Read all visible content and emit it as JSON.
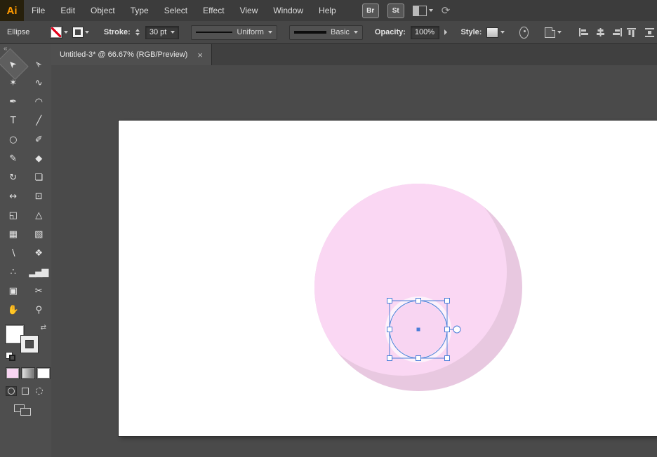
{
  "app": {
    "logo": "Ai"
  },
  "menubar": {
    "items": [
      "File",
      "Edit",
      "Object",
      "Type",
      "Select",
      "Effect",
      "View",
      "Window",
      "Help"
    ],
    "bridge_badge": "Br",
    "stock_badge": "St",
    "sync_glyph": "⟳"
  },
  "controls": {
    "tool_label": "Ellipse",
    "stroke_label": "Stroke:",
    "stroke_value": "30 pt",
    "profile_value": "Uniform",
    "brush_value": "Basic",
    "opacity_label": "Opacity:",
    "opacity_value": "100%",
    "style_label": "Style:"
  },
  "document_tab": {
    "title": "Untitled-3* @ 66.67% (RGB/Preview)",
    "close_glyph": "×"
  },
  "toolbar": {
    "collapse_glyph": "«",
    "swap_glyph": "⇄",
    "active_tool": "selection-tool",
    "tools": [
      {
        "name": "selection-tool",
        "glyph": "➤"
      },
      {
        "name": "direct-selection-tool",
        "glyph": "➢"
      },
      {
        "name": "magic-wand-tool",
        "glyph": "✶"
      },
      {
        "name": "lasso-tool",
        "glyph": "∿"
      },
      {
        "name": "pen-tool",
        "glyph": "✒"
      },
      {
        "name": "curvature-tool",
        "glyph": "◠"
      },
      {
        "name": "type-tool",
        "glyph": "T"
      },
      {
        "name": "line-segment-tool",
        "glyph": "╱"
      },
      {
        "name": "ellipse-tool",
        "glyph": "○"
      },
      {
        "name": "paintbrush-tool",
        "glyph": "✐"
      },
      {
        "name": "pencil-tool",
        "glyph": "✎"
      },
      {
        "name": "eraser-tool",
        "glyph": "◆"
      },
      {
        "name": "rotate-tool",
        "glyph": "↻"
      },
      {
        "name": "scale-tool",
        "glyph": "❏"
      },
      {
        "name": "width-tool",
        "glyph": "↔"
      },
      {
        "name": "free-transform-tool",
        "glyph": "⊡"
      },
      {
        "name": "shape-builder-tool",
        "glyph": "◱"
      },
      {
        "name": "perspective-grid-tool",
        "glyph": "△"
      },
      {
        "name": "mesh-tool",
        "glyph": "▦"
      },
      {
        "name": "gradient-tool",
        "glyph": "▧"
      },
      {
        "name": "eyedropper-tool",
        "glyph": "∖"
      },
      {
        "name": "blend-tool",
        "glyph": "❖"
      },
      {
        "name": "symbol-sprayer-tool",
        "glyph": "∴"
      },
      {
        "name": "column-graph-tool",
        "glyph": "▂▄▆"
      },
      {
        "name": "artboard-tool",
        "glyph": "▣"
      },
      {
        "name": "slice-tool",
        "glyph": "✂"
      },
      {
        "name": "hand-tool",
        "glyph": "✋"
      },
      {
        "name": "zoom-tool",
        "glyph": "⚲"
      }
    ]
  },
  "colors": {
    "selection_blue": "#4a7dd8",
    "pink_main": "#fad7f3",
    "pink_shadow": "#e8c8e0",
    "ring_white": "#fdf2fb",
    "pink_small": "#f8d5f2",
    "logo_orange": "#ff9a00",
    "swatch_none_red": "#e2001a"
  }
}
